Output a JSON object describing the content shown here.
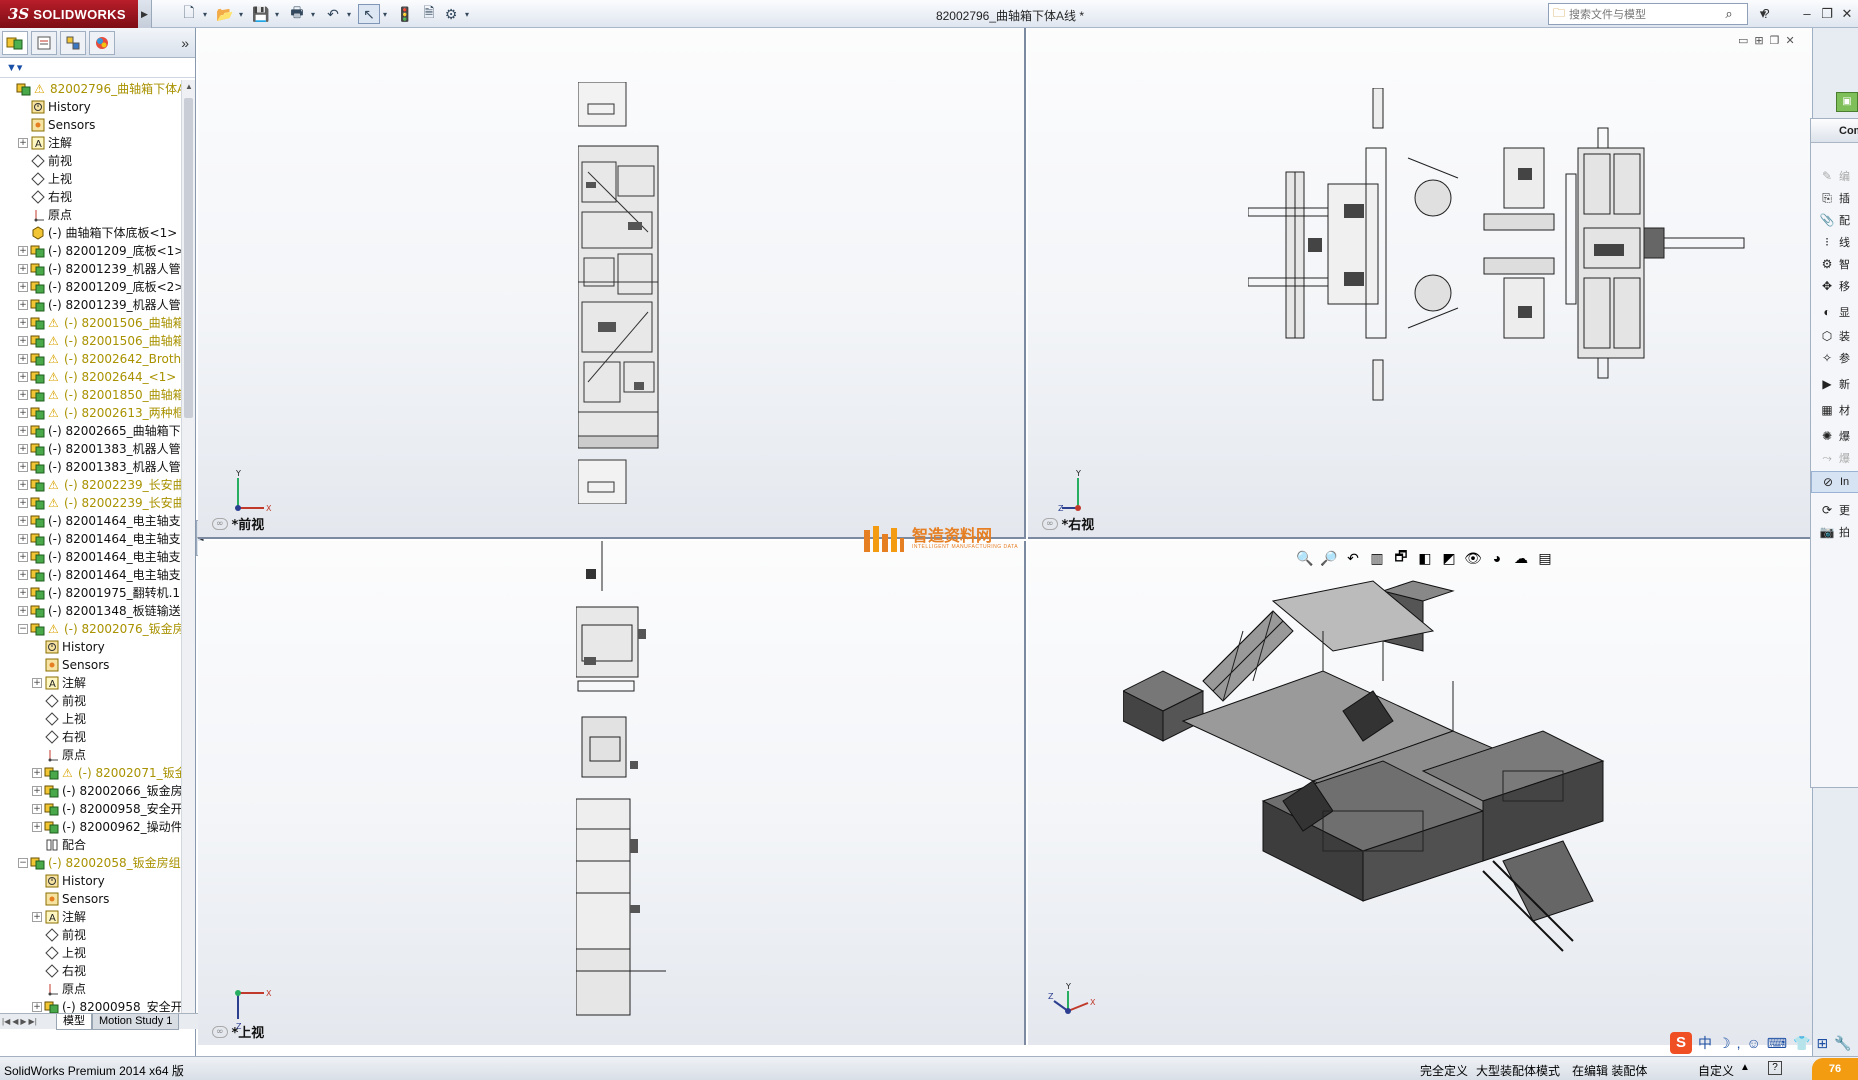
{
  "app": {
    "logo_ds": "3S",
    "logo_name": "SOLIDWORKS",
    "document_title": "82002796_曲轴箱下体A线 *"
  },
  "quick_access": {
    "icons": [
      "new-icon",
      "open-icon",
      "save-icon",
      "print-icon",
      "undo-icon",
      "select-icon",
      "rebuild-icon",
      "file-properties-icon",
      "options-icon"
    ]
  },
  "search": {
    "placeholder": "搜索文件与模型"
  },
  "window_controls": {
    "help": "?",
    "minimize": "–",
    "restore": "❐",
    "close": "✕"
  },
  "feature_tree": {
    "items": [
      {
        "level": 0,
        "exp": "",
        "icon": "assembly-icon",
        "warn": true,
        "yellow": true,
        "label": "82002796_曲轴箱下体A线"
      },
      {
        "level": 1,
        "exp": "",
        "icon": "history-icon",
        "warn": false,
        "yellow": false,
        "label": "History"
      },
      {
        "level": 1,
        "exp": "",
        "icon": "sensors-icon",
        "warn": false,
        "yellow": false,
        "label": "Sensors"
      },
      {
        "level": 1,
        "exp": "+",
        "icon": "annotations-icon",
        "warn": false,
        "yellow": false,
        "label": "注解"
      },
      {
        "level": 1,
        "exp": "",
        "icon": "plane-icon",
        "warn": false,
        "yellow": false,
        "label": "前视"
      },
      {
        "level": 1,
        "exp": "",
        "icon": "plane-icon",
        "warn": false,
        "yellow": false,
        "label": "上视"
      },
      {
        "level": 1,
        "exp": "",
        "icon": "plane-icon",
        "warn": false,
        "yellow": false,
        "label": "右视"
      },
      {
        "level": 1,
        "exp": "",
        "icon": "origin-icon",
        "warn": false,
        "yellow": false,
        "label": "原点"
      },
      {
        "level": 1,
        "exp": "",
        "icon": "part-icon",
        "warn": false,
        "yellow": false,
        "label": "(-) 曲轴箱下体底板<1> (默"
      },
      {
        "level": 1,
        "exp": "+",
        "icon": "assembly-icon",
        "warn": false,
        "yellow": false,
        "label": "(-) 82001209_底板<1> (默"
      },
      {
        "level": 1,
        "exp": "+",
        "icon": "assembly-icon",
        "warn": false,
        "yellow": false,
        "label": "(-) 82001239_机器人管线"
      },
      {
        "level": 1,
        "exp": "+",
        "icon": "assembly-icon",
        "warn": false,
        "yellow": false,
        "label": "(-) 82001209_底板<2> (默"
      },
      {
        "level": 1,
        "exp": "+",
        "icon": "assembly-icon",
        "warn": false,
        "yellow": false,
        "label": "(-) 82001239_机器人管线"
      },
      {
        "level": 1,
        "exp": "+",
        "icon": "assembly-icon",
        "warn": true,
        "yellow": true,
        "label": "(-) 82001506_曲轴箱双"
      },
      {
        "level": 1,
        "exp": "+",
        "icon": "assembly-icon",
        "warn": true,
        "yellow": true,
        "label": "(-) 82001506_曲轴箱双"
      },
      {
        "level": 1,
        "exp": "+",
        "icon": "assembly-icon",
        "warn": true,
        "yellow": true,
        "label": "(-) 82002642_Brother"
      },
      {
        "level": 1,
        "exp": "+",
        "icon": "assembly-icon",
        "warn": true,
        "yellow": true,
        "label": "(-) 82002644_<1> (默"
      },
      {
        "level": 1,
        "exp": "+",
        "icon": "assembly-icon",
        "warn": true,
        "yellow": true,
        "label": "(-) 82001850_曲轴箱下"
      },
      {
        "level": 1,
        "exp": "+",
        "icon": "assembly-icon",
        "warn": true,
        "yellow": true,
        "label": "(-) 82002613_两种框架"
      },
      {
        "level": 1,
        "exp": "+",
        "icon": "assembly-icon",
        "warn": false,
        "yellow": false,
        "label": "(-) 82002665_曲轴箱下体"
      },
      {
        "level": 1,
        "exp": "+",
        "icon": "assembly-icon",
        "warn": false,
        "yellow": false,
        "label": "(-) 82001383_机器人管线"
      },
      {
        "level": 1,
        "exp": "+",
        "icon": "assembly-icon",
        "warn": false,
        "yellow": false,
        "label": "(-) 82001383_机器人管线"
      },
      {
        "level": 1,
        "exp": "+",
        "icon": "assembly-icon",
        "warn": true,
        "yellow": true,
        "label": "(-) 82002239_长安曲轴"
      },
      {
        "level": 1,
        "exp": "+",
        "icon": "assembly-icon",
        "warn": true,
        "yellow": true,
        "label": "(-) 82002239_长安曲轴"
      },
      {
        "level": 1,
        "exp": "+",
        "icon": "assembly-icon",
        "warn": false,
        "yellow": false,
        "label": "(-) 82001464_电主轴支架"
      },
      {
        "level": 1,
        "exp": "+",
        "icon": "assembly-icon",
        "warn": false,
        "yellow": false,
        "label": "(-) 82001464_电主轴支架"
      },
      {
        "level": 1,
        "exp": "+",
        "icon": "assembly-icon",
        "warn": false,
        "yellow": false,
        "label": "(-) 82001464_电主轴支架"
      },
      {
        "level": 1,
        "exp": "+",
        "icon": "assembly-icon",
        "warn": false,
        "yellow": false,
        "label": "(-) 82001464_电主轴支架"
      },
      {
        "level": 1,
        "exp": "+",
        "icon": "assembly-icon",
        "warn": false,
        "yellow": false,
        "label": "(-) 82001975_翻转机.1<1"
      },
      {
        "level": 1,
        "exp": "+",
        "icon": "assembly-icon",
        "warn": false,
        "yellow": false,
        "label": "(-) 82001348_板链输送机"
      },
      {
        "level": 1,
        "exp": "−",
        "icon": "assembly-icon",
        "warn": true,
        "yellow": true,
        "label": "(-) 82002076_钣金房组"
      },
      {
        "level": 2,
        "exp": "",
        "icon": "history-icon",
        "warn": false,
        "yellow": false,
        "label": "History"
      },
      {
        "level": 2,
        "exp": "",
        "icon": "sensors-icon",
        "warn": false,
        "yellow": false,
        "label": "Sensors"
      },
      {
        "level": 2,
        "exp": "+",
        "icon": "annotations-icon",
        "warn": false,
        "yellow": false,
        "label": "注解"
      },
      {
        "level": 2,
        "exp": "",
        "icon": "plane-icon",
        "warn": false,
        "yellow": false,
        "label": "前视"
      },
      {
        "level": 2,
        "exp": "",
        "icon": "plane-icon",
        "warn": false,
        "yellow": false,
        "label": "上视"
      },
      {
        "level": 2,
        "exp": "",
        "icon": "plane-icon",
        "warn": false,
        "yellow": false,
        "label": "右视"
      },
      {
        "level": 2,
        "exp": "",
        "icon": "origin-icon",
        "warn": false,
        "yellow": false,
        "label": "原点"
      },
      {
        "level": 2,
        "exp": "+",
        "icon": "assembly-icon",
        "warn": true,
        "yellow": true,
        "label": "(-) 82002071_钣金"
      },
      {
        "level": 2,
        "exp": "+",
        "icon": "assembly-icon",
        "warn": false,
        "yellow": false,
        "label": "(-) 82002066_钣金房楼"
      },
      {
        "level": 2,
        "exp": "+",
        "icon": "assembly-icon",
        "warn": false,
        "yellow": false,
        "label": "(-) 82000958_安全开关"
      },
      {
        "level": 2,
        "exp": "+",
        "icon": "assembly-icon",
        "warn": false,
        "yellow": false,
        "label": "(-) 82000962_操动件<"
      },
      {
        "level": 2,
        "exp": "",
        "icon": "mates-icon",
        "warn": false,
        "yellow": false,
        "label": "配合"
      },
      {
        "level": 1,
        "exp": "−",
        "icon": "assembly-icon",
        "warn": false,
        "yellow": true,
        "label": "(-) 82002058_钣金房组"
      },
      {
        "level": 2,
        "exp": "",
        "icon": "history-icon",
        "warn": false,
        "yellow": false,
        "label": "History"
      },
      {
        "level": 2,
        "exp": "",
        "icon": "sensors-icon",
        "warn": false,
        "yellow": false,
        "label": "Sensors"
      },
      {
        "level": 2,
        "exp": "+",
        "icon": "annotations-icon",
        "warn": false,
        "yellow": false,
        "label": "注解"
      },
      {
        "level": 2,
        "exp": "",
        "icon": "plane-icon",
        "warn": false,
        "yellow": false,
        "label": "前视"
      },
      {
        "level": 2,
        "exp": "",
        "icon": "plane-icon",
        "warn": false,
        "yellow": false,
        "label": "上视"
      },
      {
        "level": 2,
        "exp": "",
        "icon": "plane-icon",
        "warn": false,
        "yellow": false,
        "label": "右视"
      },
      {
        "level": 2,
        "exp": "",
        "icon": "origin-icon",
        "warn": false,
        "yellow": false,
        "label": "原点"
      },
      {
        "level": 2,
        "exp": "+",
        "icon": "assembly-icon",
        "warn": false,
        "yellow": false,
        "label": "(-) 82000958_安全开关"
      },
      {
        "level": 2,
        "exp": "+",
        "icon": "assembly-icon",
        "warn": false,
        "yellow": false,
        "label": "(-) 82000962_操动件"
      }
    ]
  },
  "bottom_tabs": {
    "model": "模型",
    "motion": "Motion Study 1"
  },
  "viewports": {
    "front": "*前视",
    "right": "*右视",
    "top": "*上视"
  },
  "watermark": {
    "title": "智造资料网",
    "subtitle": "INTELLIGENT MANUFACTURING DATA"
  },
  "task_pane": {
    "header": "Com",
    "items": [
      {
        "icon": "edit-icon",
        "label": "编",
        "disabled": true
      },
      {
        "icon": "insert-icon",
        "label": "插",
        "disabled": false
      },
      {
        "icon": "mate-icon",
        "label": "配",
        "disabled": false
      },
      {
        "icon": "linear-pattern-icon",
        "label": "线",
        "disabled": false
      },
      {
        "icon": "smart-fastener-icon",
        "label": "智",
        "disabled": false
      },
      {
        "icon": "move-component-icon",
        "label": "移",
        "disabled": false
      },
      {
        "icon": "show-hidden-icon",
        "label": "显",
        "disabled": false
      },
      {
        "icon": "assembly-feature-icon",
        "label": "装",
        "disabled": false
      },
      {
        "icon": "reference-geometry-icon",
        "label": "参",
        "disabled": false
      },
      {
        "icon": "new-motion-icon",
        "label": "新",
        "disabled": false
      },
      {
        "icon": "bill-of-materials-icon",
        "label": "材",
        "disabled": false
      },
      {
        "icon": "exploded-view-icon",
        "label": "爆",
        "disabled": false
      },
      {
        "icon": "explode-line-icon",
        "label": "爆",
        "disabled": true
      },
      {
        "icon": "interference-icon",
        "label": "In",
        "disabled": false,
        "selected": true
      },
      {
        "icon": "update-icon",
        "label": "更",
        "disabled": false
      },
      {
        "icon": "snapshot-icon",
        "label": "拍",
        "disabled": false
      }
    ]
  },
  "statusbar": {
    "app_version": "SolidWorks Premium 2014 x64 版",
    "fully_defined": "完全定义",
    "large_assembly": "大型装配体模式",
    "editing": "在编辑 装配体",
    "custom": "自定义",
    "help_icon": "?"
  },
  "ime": {
    "logo": "S",
    "mode": "中",
    "badge": "76"
  }
}
